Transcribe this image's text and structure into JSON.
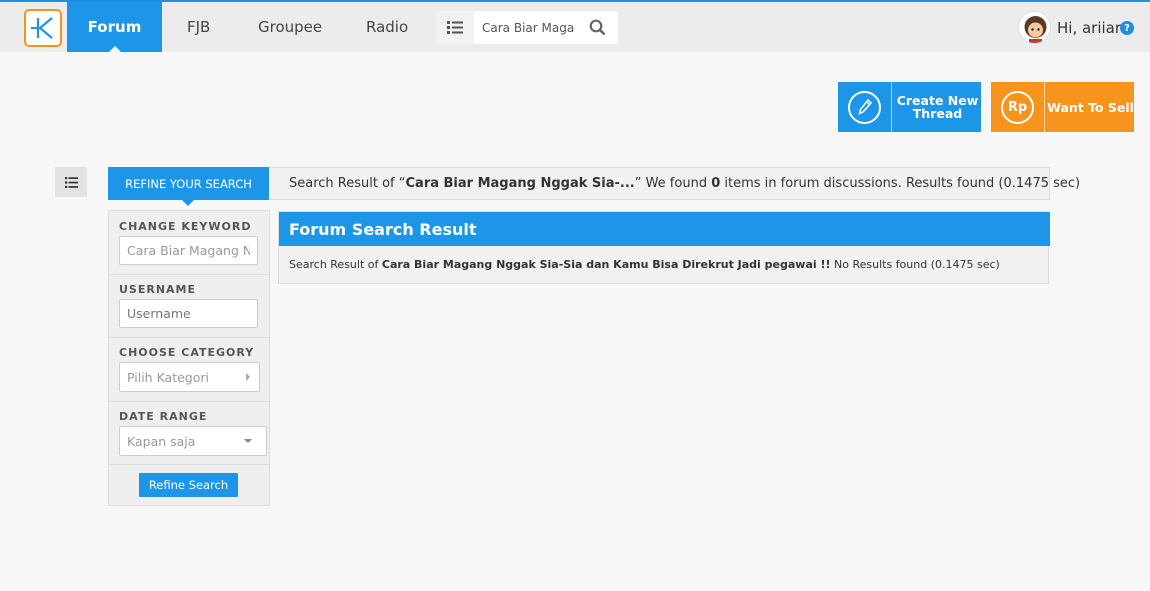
{
  "nav": {
    "items": [
      "Forum",
      "FJB",
      "Groupee",
      "Radio"
    ],
    "search_value": "Cara Biar Magang",
    "greeting": "Hi, ariiar",
    "help": "?"
  },
  "actions": {
    "create_label": "Create New Thread",
    "sell_label": "Want To Sell",
    "sell_icon": "Rp"
  },
  "refine": {
    "tab_label": "REFINE YOUR SEARCH",
    "keyword_label": "CHANGE KEYWORD",
    "keyword_value": "Cara Biar Magang Ng",
    "username_label": "USERNAME",
    "username_placeholder": "Username",
    "category_label": "CHOOSE CATEGORY",
    "category_value": "Pilih Kategori",
    "date_label": "DATE RANGE",
    "date_value": "Kapan saja",
    "button_label": "Refine Search"
  },
  "summary": {
    "prefix": "Search Result of “",
    "query_short": "Cara Biar Magang Nggak Sia-...",
    "middle": "” We found ",
    "count": "0",
    "suffix": " items in forum discussions. Results found (0.1475 sec)"
  },
  "results": {
    "title": "Forum Search Result",
    "prefix": "Search Result of ",
    "query_full": "Cara Biar Magang Nggak Sia-Sia dan Kamu Bisa Direkrut Jadi pegawai !!",
    "suffix": " No Results found (0.1475 sec)"
  },
  "colors": {
    "primary_blue": "#1e96e8",
    "accent_orange": "#f7941d"
  }
}
